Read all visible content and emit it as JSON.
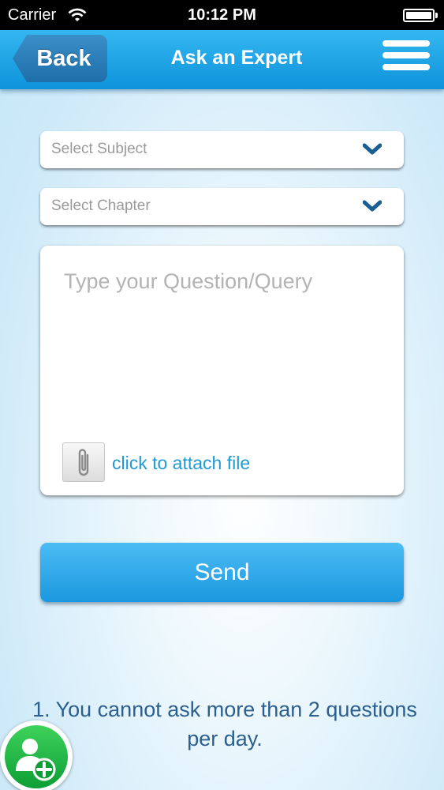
{
  "status_bar": {
    "carrier": "Carrier",
    "time": "10:12 PM",
    "icons": [
      "wifi-icon",
      "battery-icon"
    ]
  },
  "nav": {
    "back_label": "Back",
    "title": "Ask an Expert",
    "menu_icon": "hamburger-menu-icon"
  },
  "form": {
    "subject_placeholder": "Select Subject",
    "chapter_placeholder": "Select Chapter",
    "question_placeholder": "Type your Question/Query",
    "question_value": "",
    "attach_label": "click to attach file",
    "attach_icon": "paperclip-icon",
    "send_label": "Send"
  },
  "note": {
    "text": "1. You cannot ask more than 2 questions per day."
  },
  "fab": {
    "icon": "add-user-icon"
  },
  "colors": {
    "nav_bar": "#1fa4e6",
    "back_button": "#2a7fbd",
    "send_button": "#2aa7e8",
    "link": "#1f9ad6",
    "note_text": "#2b5f8f",
    "fab": "#1fb646"
  }
}
